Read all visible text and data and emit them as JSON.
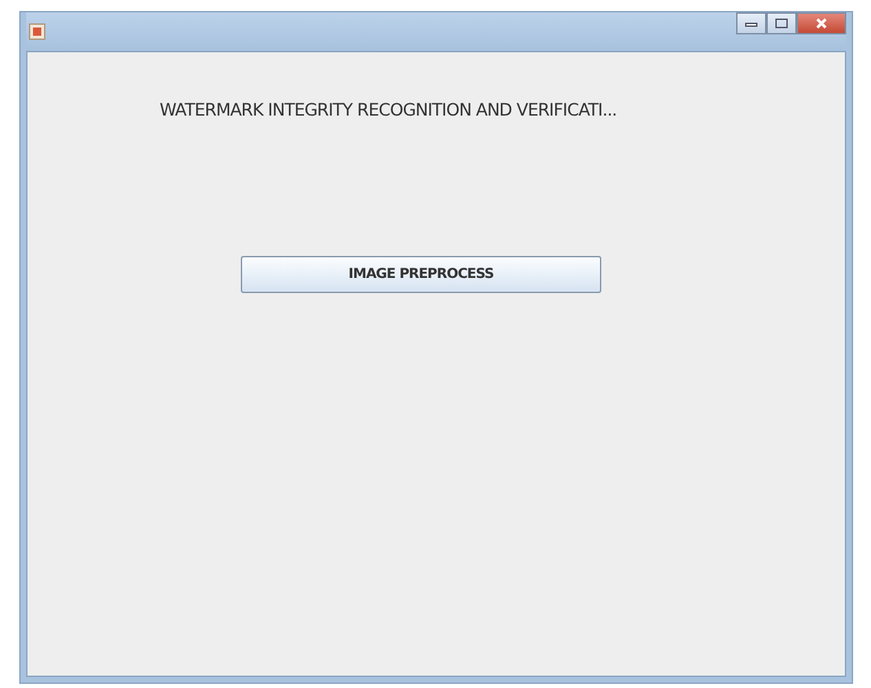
{
  "window": {
    "title_bar": {
      "buttons": [
        {
          "kind": "minimize"
        },
        {
          "kind": "maximize"
        },
        {
          "kind": "close"
        }
      ]
    }
  },
  "heading": "WATERMARK INTEGRITY RECOGNITION AND VERIFICATI...",
  "buttons": [
    {
      "label": "IMAGE PREPROCESS"
    }
  ]
}
